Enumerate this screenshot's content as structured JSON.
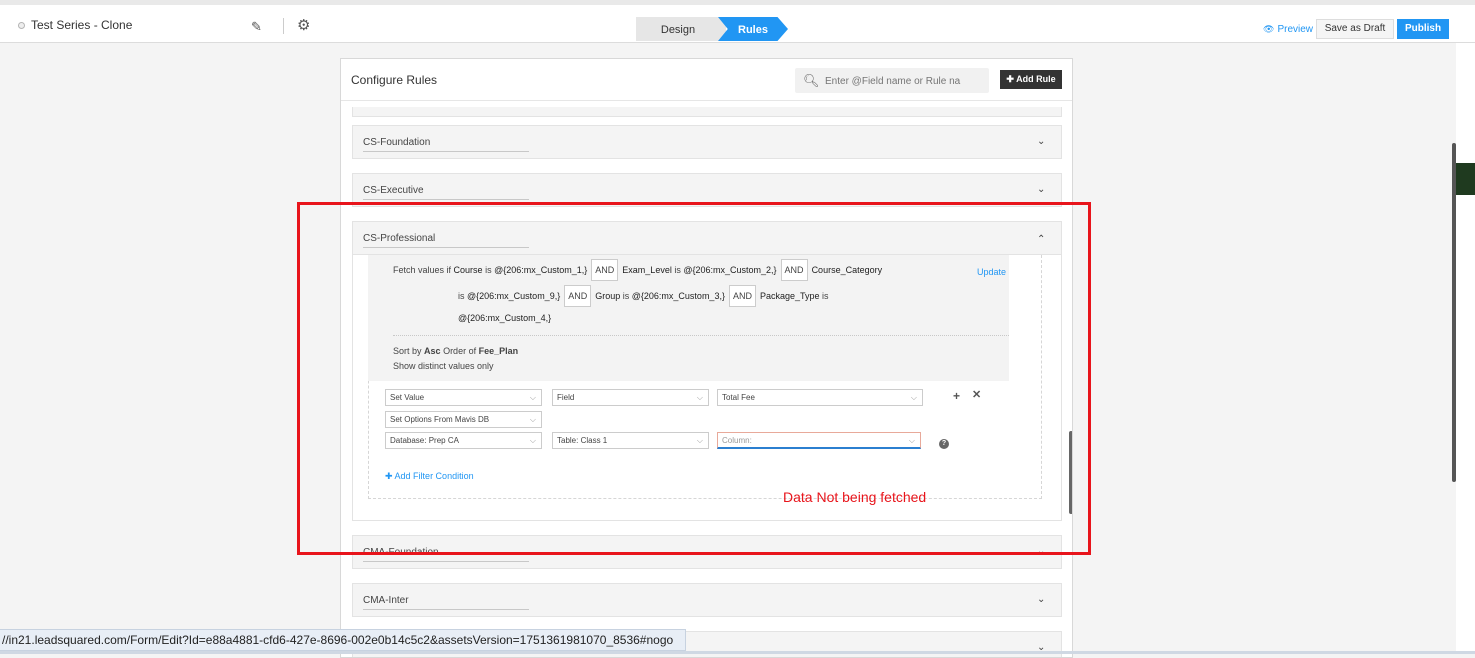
{
  "header": {
    "form_title": "Test Series - Clone",
    "edit_icon": "pencil-icon",
    "settings_icon": "gear-icon",
    "steps": [
      "Design",
      "Rules"
    ],
    "active_step": "Rules",
    "preview_label": "Preview",
    "save_draft_label": "Save as Draft",
    "publish_label": "Publish",
    "accent_color": "#2196f3"
  },
  "panel": {
    "title": "Configure Rules",
    "search_placeholder": "Enter @Field name or Rule na",
    "add_rule_label": "Add Rule"
  },
  "accordions": [
    {
      "label": "CS-Foundation",
      "expanded": false
    },
    {
      "label": "CS-Executive",
      "expanded": false
    },
    {
      "label": "CS-Professional",
      "expanded": true
    },
    {
      "label": "CMA-Foundation",
      "expanded": false
    },
    {
      "label": "CMA-Inter",
      "expanded": false
    }
  ],
  "rule": {
    "fetch_prefix": "Fetch values if",
    "conditions": [
      {
        "field": "Course",
        "op": "is",
        "value": "@{206:mx_Custom_1,}"
      },
      {
        "field": "Exam_Level",
        "op": "is",
        "value": "@{206:mx_Custom_2,}"
      },
      {
        "field": "Course_Category",
        "op": "is",
        "value": "@{206:mx_Custom_9,}"
      },
      {
        "field": "Group",
        "op": "is",
        "value": "@{206:mx_Custom_3,}"
      },
      {
        "field": "Package_Type",
        "op": "is",
        "value": "@{206:mx_Custom_4,}"
      }
    ],
    "joiner": "AND",
    "update_label": "Update",
    "sort_prefix": "Sort by",
    "sort_order": "Asc",
    "sort_mid": "Order of",
    "sort_field": "Fee_Plan",
    "distinct_label": "Show distinct values only",
    "action": {
      "action_type": "Set Value",
      "target_kind": "Field",
      "target_field": "Total Fee",
      "option_source": "Set Options From Mavis DB",
      "database": "Database: Prep CA",
      "table": "Table: Class 1",
      "column_placeholder": "Column:"
    },
    "add_filter_label": "Add Filter Condition"
  },
  "annotation": {
    "text": "Data Not being fetched",
    "color": "#e8141b"
  },
  "status_bar": {
    "url": "//in21.leadsquared.com/Form/Edit?Id=e88a4881-cfd6-427e-8696-002e0b14c5c2&assetsVersion=1751361981070_8536#nogo"
  }
}
